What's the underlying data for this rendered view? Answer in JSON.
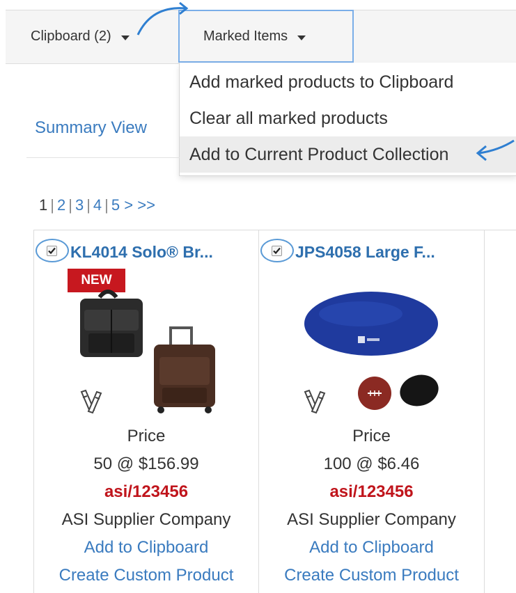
{
  "toolbar": {
    "clipboard_label": "Clipboard (2)",
    "marked_label": "Marked Items"
  },
  "marked_menu": {
    "items": [
      "Add marked products to Clipboard",
      "Clear all marked products",
      "Add to Current Product Collection"
    ]
  },
  "summary_view": "Summary View",
  "pagination": {
    "current": "1",
    "pages": [
      "2",
      "3",
      "4",
      "5"
    ],
    "next": ">",
    "last": ">>"
  },
  "products": [
    {
      "title": "KL4014  Solo® Br...",
      "badge": "NEW",
      "price_label": "Price",
      "price": "50 @ $156.99",
      "asi": "asi/123456",
      "supplier": "ASI Supplier Company",
      "add_link": "Add to Clipboard",
      "custom_link": "Create Custom Product"
    },
    {
      "title": "JPS4058  Large F...",
      "price_label": "Price",
      "price": "100 @ $6.46",
      "asi": "asi/123456",
      "supplier": "ASI Supplier Company",
      "add_link": "Add to Clipboard",
      "custom_link": "Create Custom Product"
    }
  ],
  "colors": {
    "link": "#3a7bbf",
    "title_link": "#2e6fae",
    "asi_red": "#c0151c",
    "badge_red": "#c7181f",
    "annotation_blue": "#2f7fd1"
  }
}
